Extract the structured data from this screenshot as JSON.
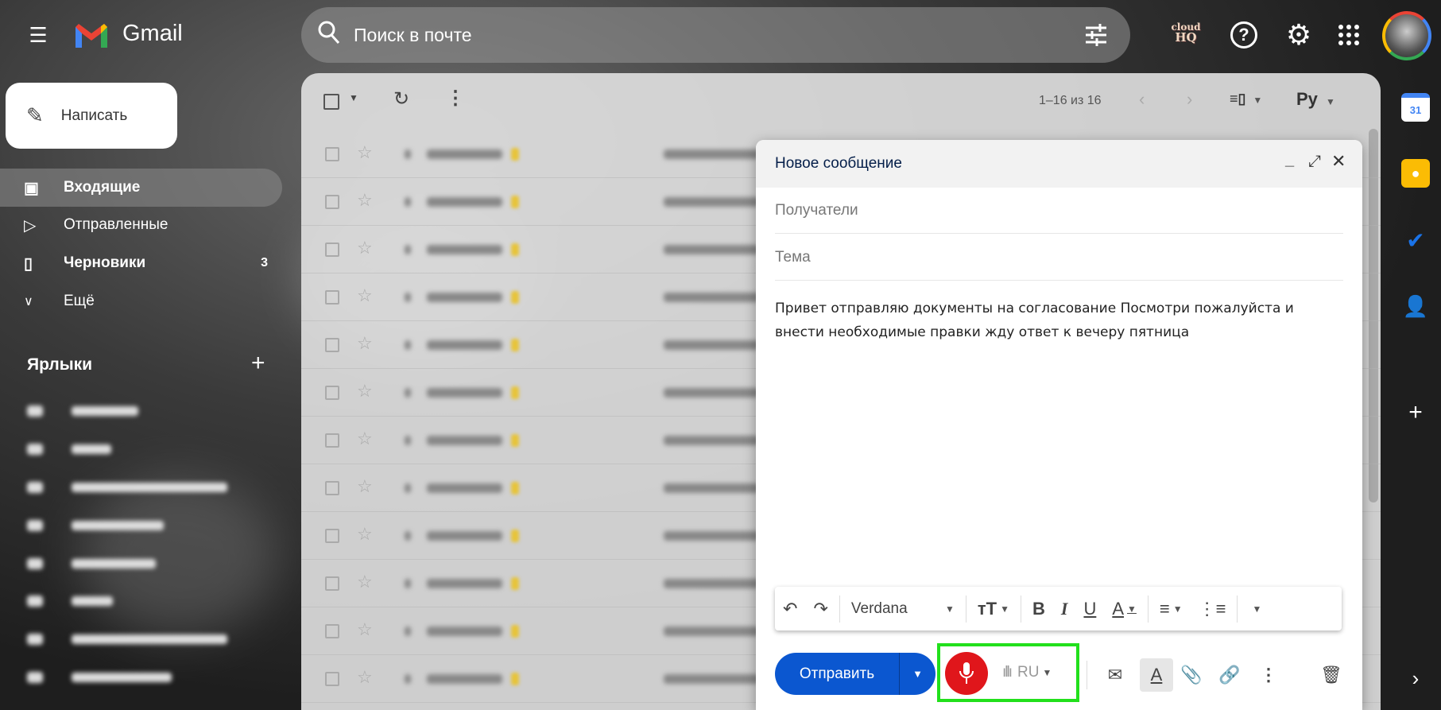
{
  "header": {
    "app_name": "Gmail",
    "search_placeholder": "Поиск в почте",
    "cloudhq_line1": "cloud",
    "cloudhq_line2": "HQ"
  },
  "sidebar": {
    "compose_label": "Написать",
    "items": [
      {
        "label": "Входящие",
        "icon": "inbox-icon",
        "count": ""
      },
      {
        "label": "Отправленные",
        "icon": "send-icon",
        "count": ""
      },
      {
        "label": "Черновики",
        "icon": "draft-icon",
        "count": "3"
      },
      {
        "label": "Ещё",
        "icon": "chevron-down-icon",
        "count": ""
      }
    ],
    "labels_title": "Ярлыки"
  },
  "list": {
    "pagination": "1–16 из 16",
    "lang_button": "Ру"
  },
  "compose": {
    "title": "Новое сообщение",
    "recipients_placeholder": "Получатели",
    "subject_placeholder": "Тема",
    "body": "Привет отправляю документы на согласование Посмотри пожалуйста и внести необходимые правки жду ответ к вечеру пятница",
    "font": "Verdana",
    "send_label": "Отправить",
    "voice_lang": "RU"
  },
  "side_panel": {
    "calendar_day": "31"
  },
  "colors": {
    "send": "#0b57d0",
    "mic": "#e0161b",
    "highlight": "#22e01c"
  }
}
